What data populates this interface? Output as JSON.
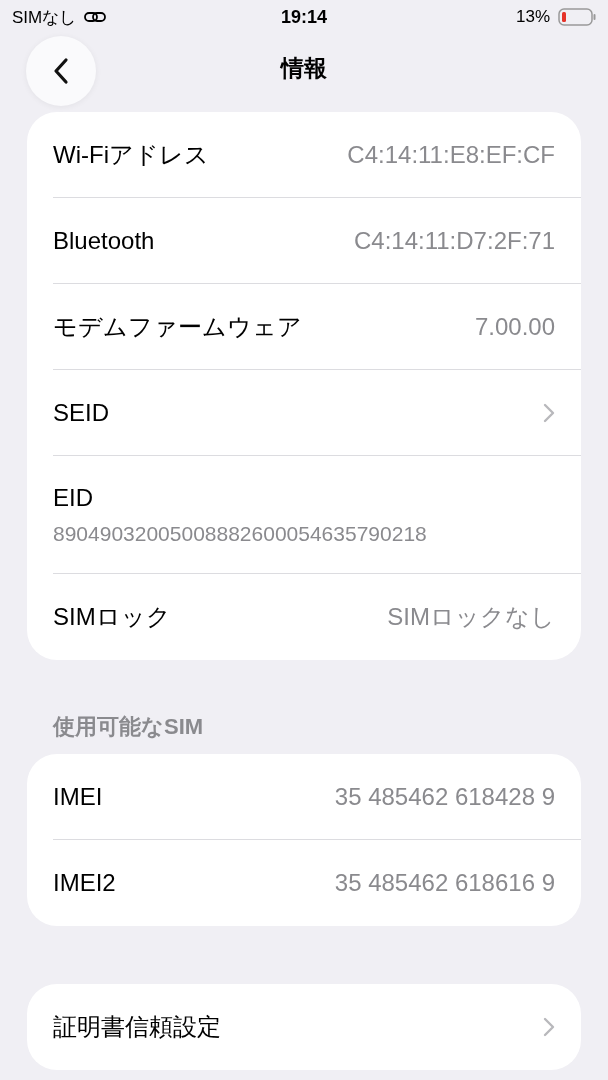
{
  "status_bar": {
    "carrier": "SIMなし",
    "time": "19:14",
    "battery": "13%"
  },
  "nav": {
    "title": "情報"
  },
  "groups": [
    {
      "rows": [
        {
          "kind": "value",
          "label": "Wi-Fiアドレス",
          "value": "C4:14:11:E8:EF:CF"
        },
        {
          "kind": "value",
          "label": "Bluetooth",
          "value": "C4:14:11:D7:2F:71"
        },
        {
          "kind": "value",
          "label": "モデムファームウェア",
          "value": "7.00.00"
        },
        {
          "kind": "chevron",
          "label": "SEID"
        },
        {
          "kind": "stacked",
          "label": "EID",
          "value": "89049032005008882600054635790218"
        },
        {
          "kind": "value",
          "label": "SIMロック",
          "value": "SIMロックなし"
        }
      ]
    },
    {
      "header": "使用可能なSIM",
      "rows": [
        {
          "kind": "value",
          "label": "IMEI",
          "value": "35 485462 618428 9"
        },
        {
          "kind": "value",
          "label": "IMEI2",
          "value": "35 485462 618616 9"
        }
      ]
    },
    {
      "rows": [
        {
          "kind": "chevron",
          "label": "証明書信頼設定"
        }
      ]
    }
  ]
}
